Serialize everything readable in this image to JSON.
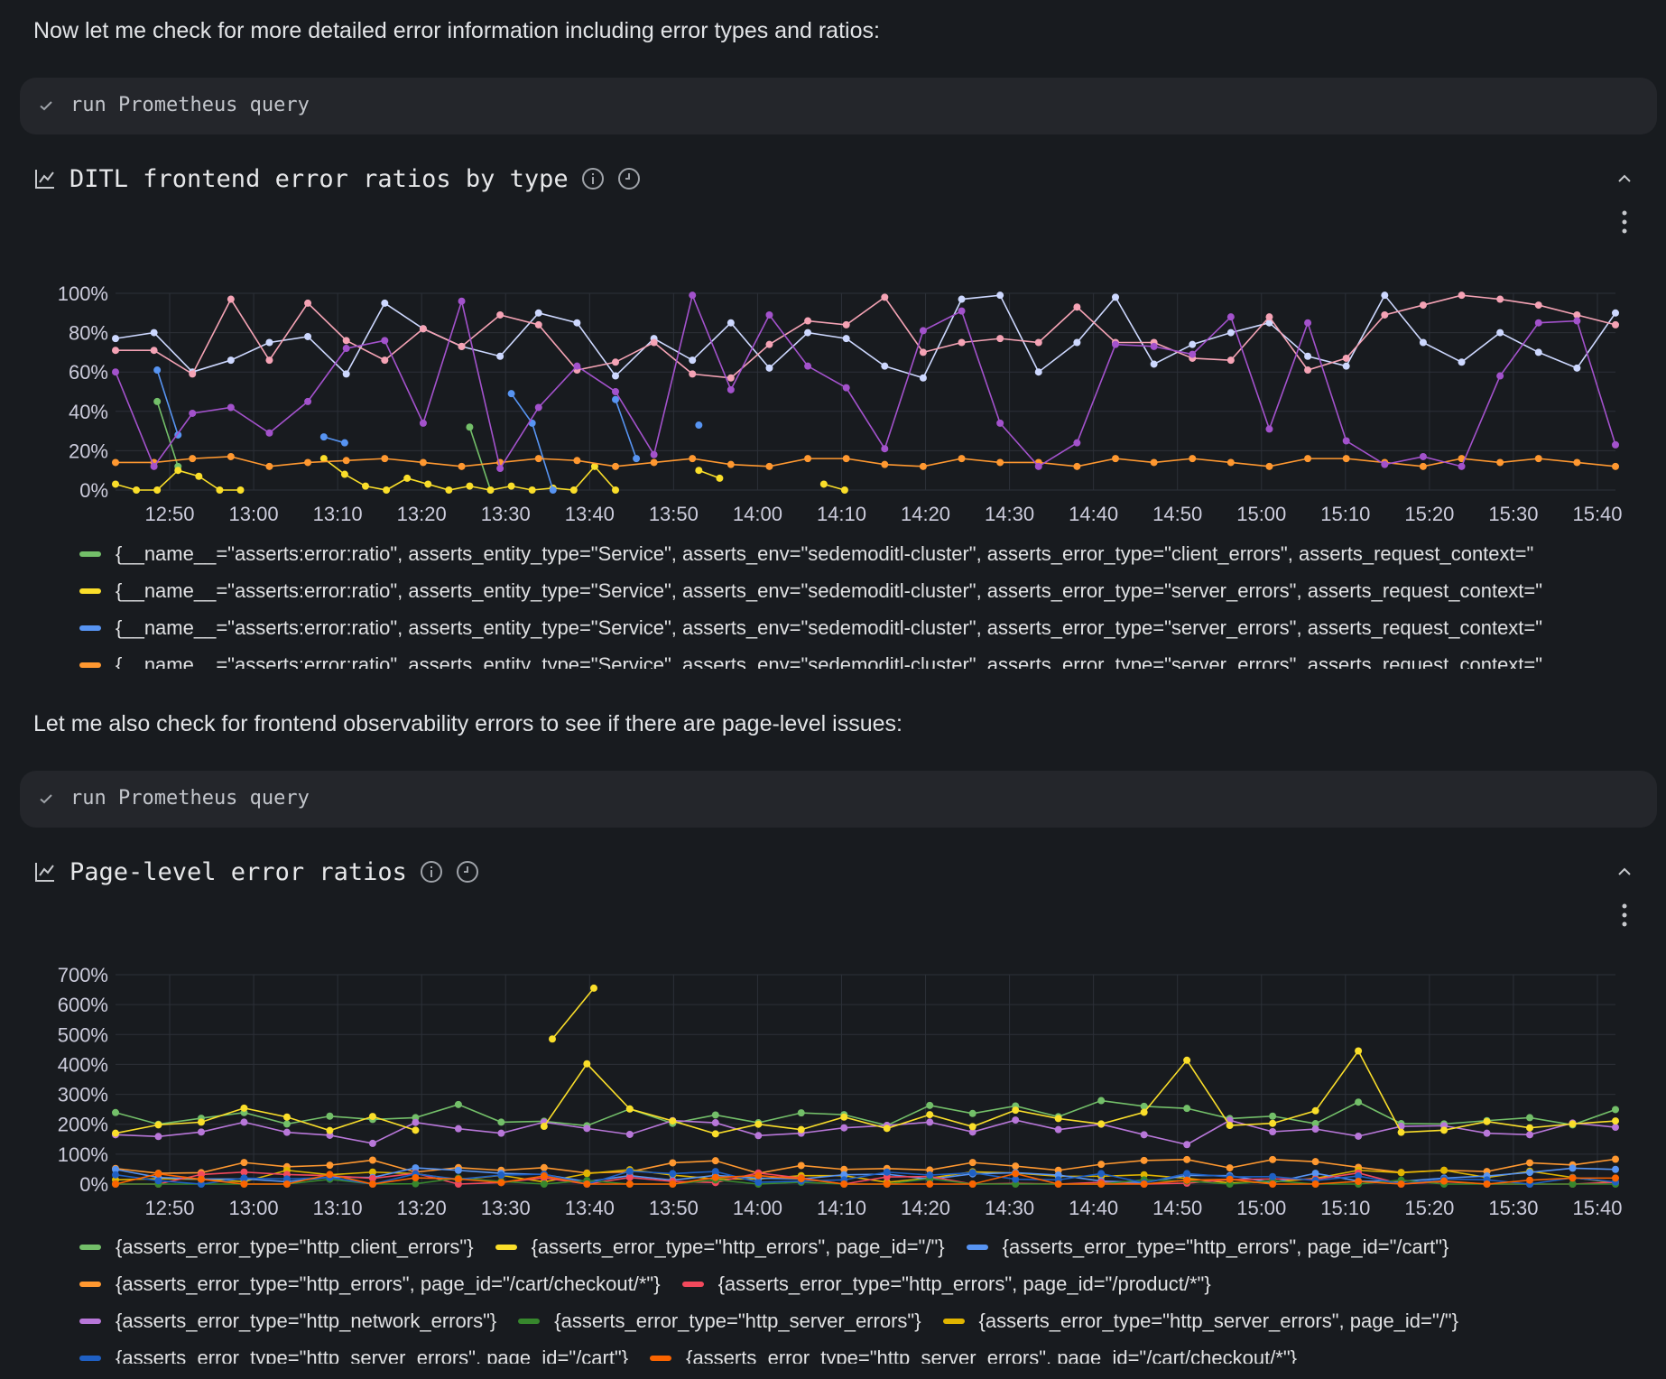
{
  "messages": {
    "intro_1": "Now let me check for more detailed error information including error types and ratios:",
    "intro_2": "Let me also check for frontend observability errors to see if there are page-level issues:"
  },
  "tool_calls": [
    {
      "label": "run Prometheus query",
      "icon": "check-icon"
    },
    {
      "label": "run Prometheus query",
      "icon": "check-icon"
    }
  ],
  "colors": {
    "background": "#181b1f",
    "tool_bg": "#24262b",
    "grid": "#2c3038"
  },
  "chart_data": [
    {
      "type": "line",
      "title": "DITL frontend error ratios by type",
      "x": [
        "12:50",
        "13:00",
        "13:10",
        "13:20",
        "13:30",
        "13:40",
        "13:50",
        "14:00",
        "14:10",
        "14:20",
        "14:30",
        "14:40",
        "14:50",
        "15:00",
        "15:10",
        "15:20",
        "15:30",
        "15:40"
      ],
      "yticks": [
        "0%",
        "20%",
        "40%",
        "60%",
        "80%",
        "100%"
      ],
      "ylim": [
        0,
        100
      ],
      "grid": true,
      "legend_position": "bottom",
      "series": [
        {
          "name": "{__name__=\"asserts:error:ratio\", asserts_entity_type=\"Service\", asserts_env=\"sedemoditl-cluster\", asserts_error_type=\"client_errors\", asserts_request_context=\"",
          "color": "#73bf69",
          "values": [
            null,
            null,
            45,
            12,
            null,
            null,
            null,
            null,
            null,
            null,
            null,
            null,
            null,
            null,
            null,
            null,
            null,
            32,
            0,
            null,
            null,
            null,
            null,
            null,
            null,
            null,
            null,
            null,
            null,
            null,
            null,
            null,
            null,
            null,
            null,
            null,
            null,
            null,
            null,
            null,
            null,
            null,
            null,
            null,
            null,
            null,
            null,
            null,
            null,
            null,
            null,
            null,
            null,
            null,
            null,
            null,
            null,
            null,
            null,
            null,
            null,
            null,
            null,
            null,
            null,
            null,
            null,
            null,
            null,
            null,
            null,
            null,
            null
          ]
        },
        {
          "name": "{__name__=\"asserts:error:ratio\", asserts_entity_type=\"Service\", asserts_env=\"sedemoditl-cluster\", asserts_error_type=\"server_errors\", asserts_request_context=\"",
          "color": "#fade2a",
          "values": [
            3,
            0,
            0,
            10,
            7,
            0,
            0,
            null,
            null,
            null,
            16,
            8,
            2,
            0,
            6,
            3,
            0,
            2,
            0,
            2,
            0,
            1,
            0,
            12,
            0,
            null,
            null,
            null,
            10,
            6,
            null,
            null,
            null,
            null,
            3,
            0,
            null,
            null,
            null,
            null,
            null,
            null,
            null,
            null,
            null,
            null,
            null,
            null,
            null,
            null,
            null,
            null,
            null,
            null,
            null,
            null,
            null,
            null,
            null,
            null,
            null,
            null,
            null,
            null,
            null,
            null,
            null,
            null,
            null,
            null,
            null,
            null,
            null
          ]
        },
        {
          "name": "{__name__=\"asserts:error:ratio\", asserts_entity_type=\"Service\", asserts_env=\"sedemoditl-cluster\", asserts_error_type=\"server_errors\", asserts_request_context=\"",
          "color": "#5794f2",
          "values": [
            null,
            null,
            61,
            28,
            null,
            null,
            null,
            null,
            null,
            null,
            27,
            24,
            null,
            null,
            null,
            null,
            null,
            null,
            null,
            49,
            34,
            0,
            null,
            null,
            46,
            16,
            null,
            null,
            33,
            null,
            null,
            null,
            null,
            null,
            null,
            null,
            null,
            null,
            null,
            null,
            null,
            null,
            null,
            null,
            null,
            null,
            null,
            null,
            null,
            null,
            null,
            null,
            null,
            null,
            null,
            null,
            null,
            null,
            null,
            null,
            null,
            null,
            null,
            null,
            null,
            null,
            null,
            null,
            null,
            null,
            null,
            null,
            null
          ]
        },
        {
          "name": "{__name__=\"asserts:error:ratio\", asserts_entity_type=\"Service\", asserts_env=\"sedemoditl-cluster\", asserts_error_type=\"server_errors\", asserts_request_context=\"",
          "color": "#ff9830",
          "values": [
            14,
            14,
            16,
            17,
            12,
            14,
            15,
            16,
            14,
            12,
            14,
            16,
            15,
            12,
            14,
            16,
            13,
            12,
            16,
            16,
            13,
            12,
            16,
            14,
            14,
            12,
            16,
            14,
            16,
            14,
            12,
            16,
            16,
            14,
            12,
            16,
            14,
            16,
            14,
            12
          ]
        }
      ]
    },
    {
      "type": "line",
      "title": "Page-level error ratios",
      "x": [
        "12:50",
        "13:00",
        "13:10",
        "13:20",
        "13:30",
        "13:40",
        "13:50",
        "14:00",
        "14:10",
        "14:20",
        "14:30",
        "14:40",
        "14:50",
        "15:00",
        "15:10",
        "15:20",
        "15:30",
        "15:40"
      ],
      "yticks": [
        "0%",
        "100%",
        "200%",
        "300%",
        "400%",
        "500%",
        "600%",
        "700%"
      ],
      "ylim": [
        0,
        700
      ],
      "grid": true,
      "legend_position": "bottom",
      "series": [
        {
          "name": "{asserts_error_type=\"http_client_errors\"}",
          "color": "#73bf69"
        },
        {
          "name": "{asserts_error_type=\"http_errors\", page_id=\"/\"}",
          "color": "#fade2a"
        },
        {
          "name": "{asserts_error_type=\"http_errors\", page_id=\"/cart\"}",
          "color": "#5794f2"
        },
        {
          "name": "{asserts_error_type=\"http_errors\", page_id=\"/cart/checkout/*\"}",
          "color": "#ff9830"
        },
        {
          "name": "{asserts_error_type=\"http_errors\", page_id=\"/product/*\"}",
          "color": "#f2495c"
        },
        {
          "name": "{asserts_error_type=\"http_network_errors\"}",
          "color": "#b877d9"
        },
        {
          "name": "{asserts_error_type=\"http_server_errors\"}",
          "color": "#37872d"
        },
        {
          "name": "{asserts_error_type=\"http_server_errors\", page_id=\"/\"}",
          "color": "#e0b400"
        },
        {
          "name": "{asserts_error_type=\"http_server_errors\", page_id=\"/cart\"}",
          "color": "#1f60c4"
        },
        {
          "name": "{asserts_error_type=\"http_server_errors\", page_id=\"/cart/checkout/*\"}",
          "color": "#fa6400"
        }
      ]
    }
  ]
}
